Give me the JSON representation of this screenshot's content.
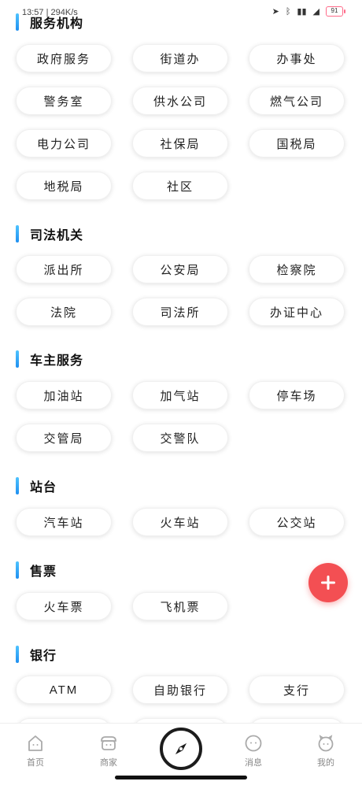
{
  "statusbar": {
    "time": "13:57",
    "speed": "294K/s",
    "battery": "91"
  },
  "sections": [
    {
      "title": "服务机构",
      "items": [
        "政府服务",
        "街道办",
        "办事处",
        "警务室",
        "供水公司",
        "燃气公司",
        "电力公司",
        "社保局",
        "国税局",
        "地税局",
        "社区"
      ]
    },
    {
      "title": "司法机关",
      "items": [
        "派出所",
        "公安局",
        "检察院",
        "法院",
        "司法所",
        "办证中心"
      ]
    },
    {
      "title": "车主服务",
      "items": [
        "加油站",
        "加气站",
        "停车场",
        "交管局",
        "交警队"
      ]
    },
    {
      "title": "站台",
      "items": [
        "汽车站",
        "火车站",
        "公交站"
      ]
    },
    {
      "title": "售票",
      "items": [
        "火车票",
        "飞机票"
      ]
    },
    {
      "title": "银行",
      "items": [
        "ATM",
        "自助银行",
        "支行"
      ]
    }
  ],
  "tabbar": {
    "home": "首页",
    "merchant": "商家",
    "messages": "消息",
    "mine": "我的"
  },
  "colors": {
    "accent": "#1f8ff0",
    "fab": "#f34f53"
  }
}
